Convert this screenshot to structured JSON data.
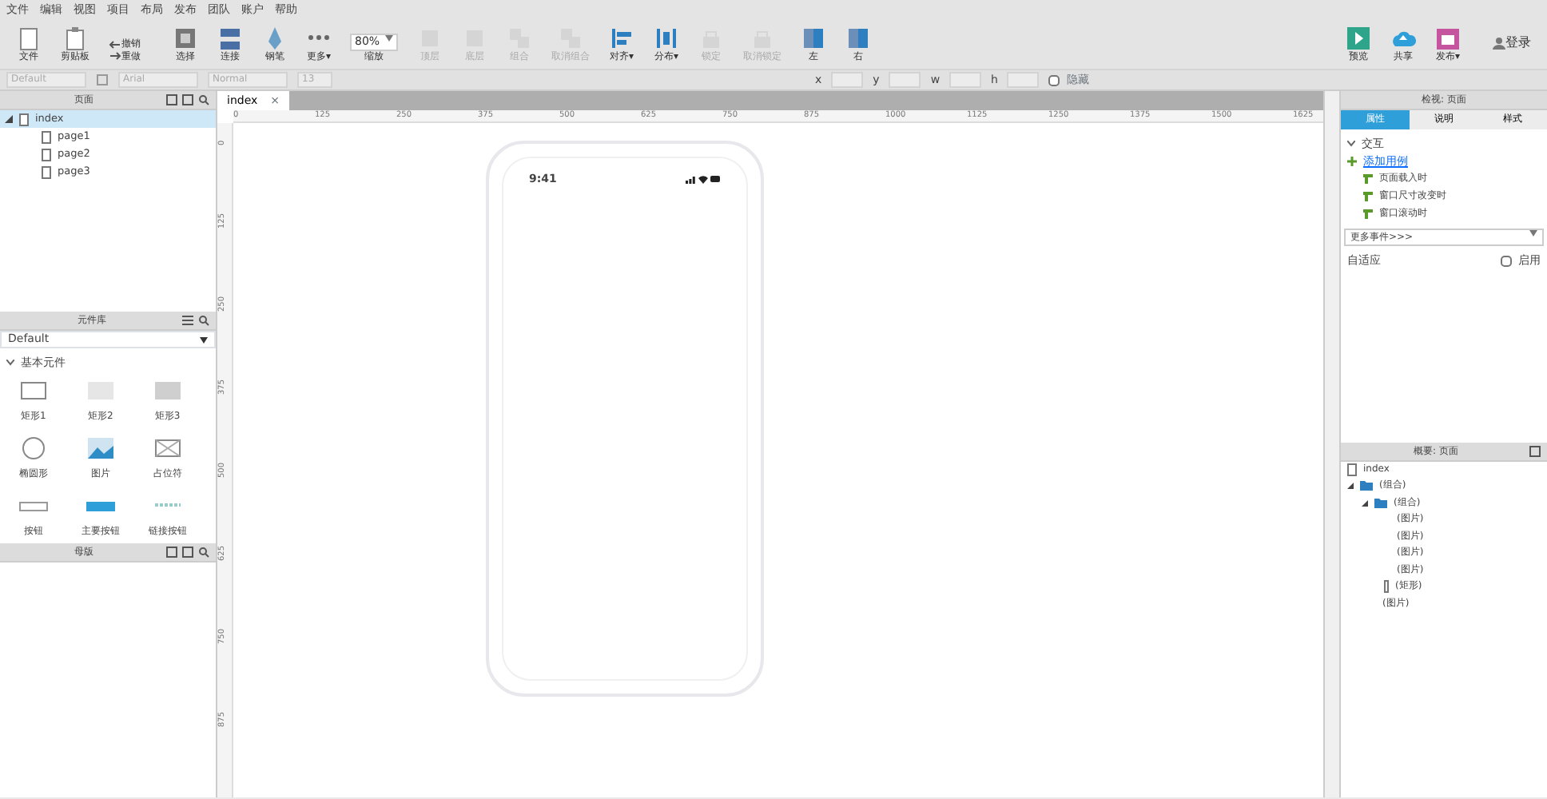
{
  "menu": [
    "文件",
    "编辑",
    "视图",
    "项目",
    "布局",
    "发布",
    "团队",
    "账户",
    "帮助"
  ],
  "toolbar": [
    {
      "label": "文件",
      "kind": "file",
      "disabled": false
    },
    {
      "label": "剪贴板",
      "kind": "clip",
      "disabled": false
    },
    {
      "label": "选择",
      "kind": "select",
      "disabled": false
    },
    {
      "label": "连接",
      "kind": "connect",
      "disabled": false
    },
    {
      "label": "钢笔",
      "kind": "pen",
      "disabled": false
    },
    {
      "label": "更多▾",
      "kind": "more",
      "disabled": false
    },
    {
      "label": "缩放",
      "kind": "zoom",
      "value": "80%",
      "disabled": false
    },
    {
      "label": "顶层",
      "kind": "layer",
      "disabled": true
    },
    {
      "label": "底层",
      "kind": "layer",
      "disabled": true
    },
    {
      "label": "组合",
      "kind": "group",
      "disabled": true
    },
    {
      "label": "取消组合",
      "kind": "group",
      "disabled": true
    },
    {
      "label": "对齐▾",
      "kind": "align",
      "disabled": false
    },
    {
      "label": "分布▾",
      "kind": "distribute",
      "disabled": false
    },
    {
      "label": "锁定",
      "kind": "lock",
      "disabled": true
    },
    {
      "label": "取消锁定",
      "kind": "lock",
      "disabled": true
    },
    {
      "label": "左",
      "kind": "panel",
      "disabled": false
    },
    {
      "label": "右",
      "kind": "panel",
      "disabled": false
    }
  ],
  "undo": [
    {
      "label": "撤销"
    },
    {
      "label": "重做"
    }
  ],
  "actions": [
    {
      "label": "预览",
      "kind": "preview"
    },
    {
      "label": "共享",
      "kind": "share"
    },
    {
      "label": "发布▾",
      "kind": "publish"
    }
  ],
  "login": "登录",
  "style_bar": {
    "style": "Default",
    "font": "Arial",
    "weight": "Normal",
    "size": "13",
    "coords": [
      "x",
      "y",
      "w",
      "h"
    ],
    "hidden": {
      "label": "隐藏",
      "checked": false
    }
  },
  "pages_panel": {
    "title": "页面",
    "items": [
      {
        "label": "index",
        "selected": true,
        "expanded": true,
        "children": [
          {
            "label": "page1",
            "selected": false
          },
          {
            "label": "page2",
            "selected": false
          },
          {
            "label": "page3",
            "selected": false
          }
        ]
      }
    ]
  },
  "library_panel": {
    "title": "元件库",
    "library": "Default",
    "section": "基本元件",
    "widgets": [
      {
        "label": "矩形1",
        "kind": "rect1"
      },
      {
        "label": "矩形2",
        "kind": "rect2"
      },
      {
        "label": "矩形3",
        "kind": "rect3"
      },
      {
        "label": "椭圆形",
        "kind": "ellipse"
      },
      {
        "label": "图片",
        "kind": "image"
      },
      {
        "label": "占位符",
        "kind": "placeholder"
      },
      {
        "label": "按钮",
        "kind": "button"
      },
      {
        "label": "主要按钮",
        "kind": "primary"
      },
      {
        "label": "链接按钮",
        "kind": "link"
      }
    ]
  },
  "masters_panel": {
    "title": "母版"
  },
  "canvas": {
    "tab": "index",
    "close": "×",
    "hruler": [
      "0",
      "125",
      "250",
      "375",
      "500",
      "625",
      "750",
      "875",
      "1000",
      "1125",
      "1250",
      "1375",
      "1500",
      "1625"
    ],
    "vruler": [
      "0",
      "125",
      "250",
      "375",
      "500",
      "625",
      "750",
      "875"
    ],
    "phone": {
      "time": "9:41"
    }
  },
  "inspector": {
    "title": "检视: 页面",
    "tabs": [
      {
        "label": "属性",
        "selected": true
      },
      {
        "label": "说明",
        "selected": false
      },
      {
        "label": "样式",
        "selected": false
      }
    ],
    "section": "交互",
    "add_case": "添加用例",
    "events": [
      "页面载入时",
      "窗口尺寸改变时",
      "窗口滚动时"
    ],
    "more_events": "更多事件>>>",
    "adaptive": {
      "label": "自适应",
      "option": "启用",
      "checked": false
    }
  },
  "outline": {
    "title": "概要: 页面",
    "root": "index",
    "items": [
      {
        "label": "(组合)",
        "kind": "folder",
        "children": [
          {
            "label": "(组合)",
            "kind": "folder",
            "children": [
              {
                "label": "(图片)",
                "kind": "item"
              },
              {
                "label": "(图片)",
                "kind": "item"
              },
              {
                "label": "(图片)",
                "kind": "item"
              },
              {
                "label": "(图片)",
                "kind": "item"
              },
              {
                "label": "(矩形)",
                "kind": "rect"
              }
            ]
          },
          {
            "label": "(图片)",
            "kind": "item"
          }
        ]
      }
    ]
  }
}
